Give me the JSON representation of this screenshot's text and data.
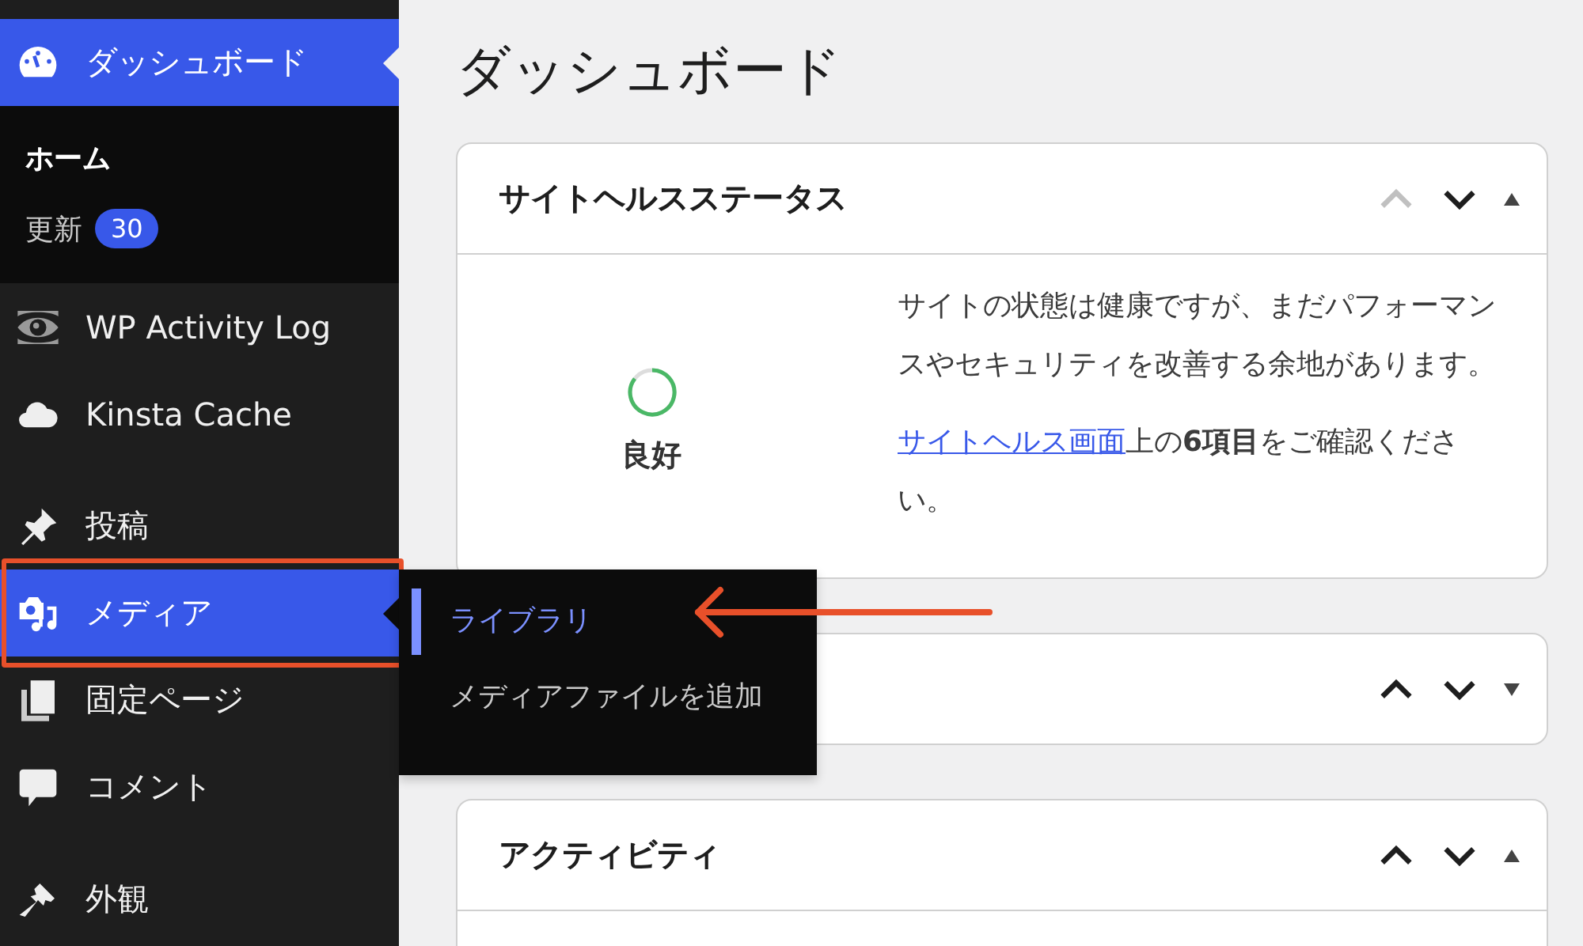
{
  "sidebar": {
    "sections": [
      {
        "items": [
          {
            "label": "ダッシュボード",
            "selected": true,
            "hovered": false,
            "submenu": [
              {
                "label": "ホーム",
                "selected": true
              },
              {
                "label": "更新",
                "badge": "30",
                "selected": false
              }
            ]
          }
        ]
      },
      {
        "items": [
          {
            "label": "WP Activity Log",
            "selected": false,
            "hovered": false
          },
          {
            "label": "Kinsta Cache",
            "selected": false,
            "hovered": false
          }
        ]
      },
      {
        "items": [
          {
            "label": "投稿",
            "selected": false,
            "hovered": false
          },
          {
            "label": "メディア",
            "selected": false,
            "hovered": true
          },
          {
            "label": "固定ページ",
            "selected": false,
            "hovered": false
          },
          {
            "label": "コメント",
            "selected": false,
            "hovered": false
          }
        ]
      },
      {
        "items": [
          {
            "label": "外観",
            "selected": false,
            "hovered": false
          }
        ]
      }
    ]
  },
  "flyout": {
    "items": [
      {
        "label": "ライブラリ",
        "selected": true
      },
      {
        "label": "メディアファイルを追加",
        "selected": false
      }
    ]
  },
  "page_title": "ダッシュボード",
  "widgets": [
    {
      "title": "サイトヘルスステータス",
      "expanded": true,
      "move_up_disabled": true,
      "status_label": "良好",
      "paragraphs": [
        "サイトの状態は健康ですが、まだパフォーマンスやセキュリティを改善する余地があります。"
      ],
      "link": "サイトヘルス画面",
      "link_tail": "上の**6項目**をご確認ください。"
    },
    {
      "expanded": false,
      "move_up_disabled": false
    },
    {
      "title": "アクティビティ",
      "expanded": true,
      "move_up_disabled": false
    }
  ]
}
